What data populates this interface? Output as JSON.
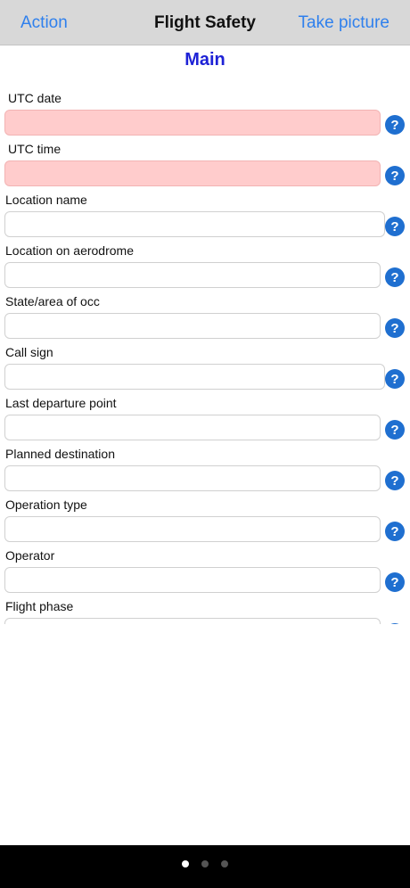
{
  "navbar": {
    "left_action": "Action",
    "title": "Flight Safety",
    "right_action": "Take picture"
  },
  "section": {
    "title": "Main"
  },
  "fields": [
    {
      "label": "UTC date",
      "value": "",
      "required": true
    },
    {
      "label": "UTC time",
      "value": "",
      "required": true
    },
    {
      "label": "Location name",
      "value": "",
      "required": false
    },
    {
      "label": "Location on aerodrome",
      "value": "",
      "required": false
    },
    {
      "label": "State/area of occ",
      "value": "",
      "required": false
    },
    {
      "label": "Call sign",
      "value": "",
      "required": false
    },
    {
      "label": "Last departure point",
      "value": "",
      "required": false
    },
    {
      "label": "Planned destination",
      "value": "",
      "required": false
    },
    {
      "label": "Operation type",
      "value": "",
      "required": false
    },
    {
      "label": "Operator",
      "value": "",
      "required": false
    },
    {
      "label": "Flight phase",
      "value": "",
      "required": false
    }
  ],
  "pager": {
    "page_count": 3,
    "current_page": 1
  },
  "colors": {
    "accent": "#2f80ed",
    "section_title": "#1e22d6",
    "required_field_bg": "#ffcccc",
    "help_icon": "#1f6fd0"
  },
  "icons": {
    "help": "help-question-circle-icon"
  }
}
